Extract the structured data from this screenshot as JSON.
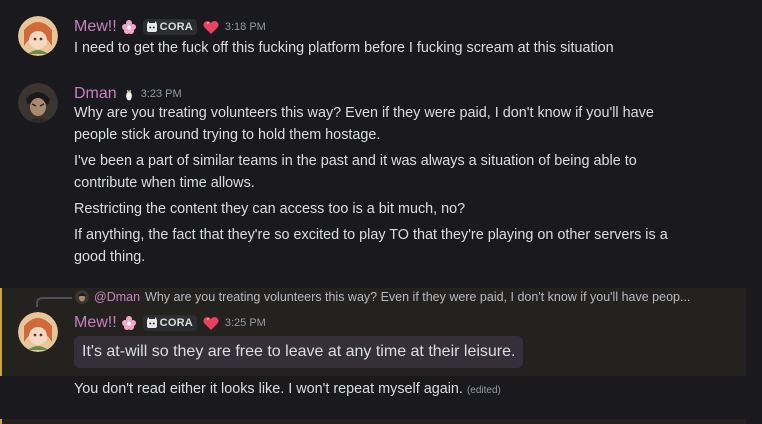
{
  "messages": [
    {
      "author": "Mew!!",
      "author_color": "#c880c1",
      "guild_tag": "CORA",
      "timestamp": "3:18 PM",
      "lines": [
        "I need to get the fuck off this fucking platform before I fucking scream at this situation"
      ]
    },
    {
      "author": "Dman",
      "author_color": "#c880c1",
      "timestamp": "3:23 PM",
      "lines": [
        "Why are you treating volunteers this way? Even if they were paid, I don't know if you'll have",
        "people stick around trying to hold them hostage.",
        "I've been a part of similar teams in the past and it was always a situation of being able to",
        "contribute when time allows.",
        "Restricting the content they can access too is a bit much, no?",
        "If anything, the fact that they're so excited to play TO that they're playing on other servers is a",
        "good thing."
      ]
    },
    {
      "reply_to": {
        "author": "@Dman",
        "preview": "Why are you treating volunteers this way? Even if they were paid, I don't know if you'll have peop..."
      },
      "author": "Mew!!",
      "author_color": "#c880c1",
      "guild_tag": "CORA",
      "timestamp": "3:25 PM",
      "highlighted": "It's at-will so they are free to leave at any time at their leisure.",
      "follow_up": "You don't read either it looks like. I won't repeat myself again.",
      "edited_label": "(edited)"
    }
  ]
}
